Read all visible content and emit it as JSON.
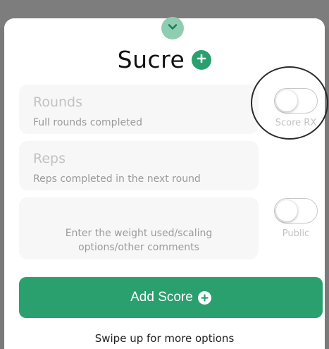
{
  "sheet": {
    "title": "Sucre",
    "icons": {
      "collapse": "chevron-down-icon",
      "add_title": "plus-circle-icon",
      "add_button": "plus-circle-icon"
    }
  },
  "form": {
    "rounds": {
      "label": "Rounds",
      "hint": "Full rounds completed"
    },
    "reps": {
      "label": "Reps",
      "hint": "Reps completed in the next round"
    },
    "comments": {
      "placeholder": "Enter the weight used/scaling options/other comments"
    },
    "score_rx": {
      "label": "Score RX",
      "on": false
    },
    "public": {
      "label": "Public",
      "on": false
    }
  },
  "actions": {
    "add_score_label": "Add Score",
    "swipe_hint": "Swipe up for more options"
  },
  "colors": {
    "accent": "#2aa06f",
    "accent_light": "#8fcdb2",
    "field_bg": "#f7f7f7",
    "overlay": "#7a7a7a"
  }
}
